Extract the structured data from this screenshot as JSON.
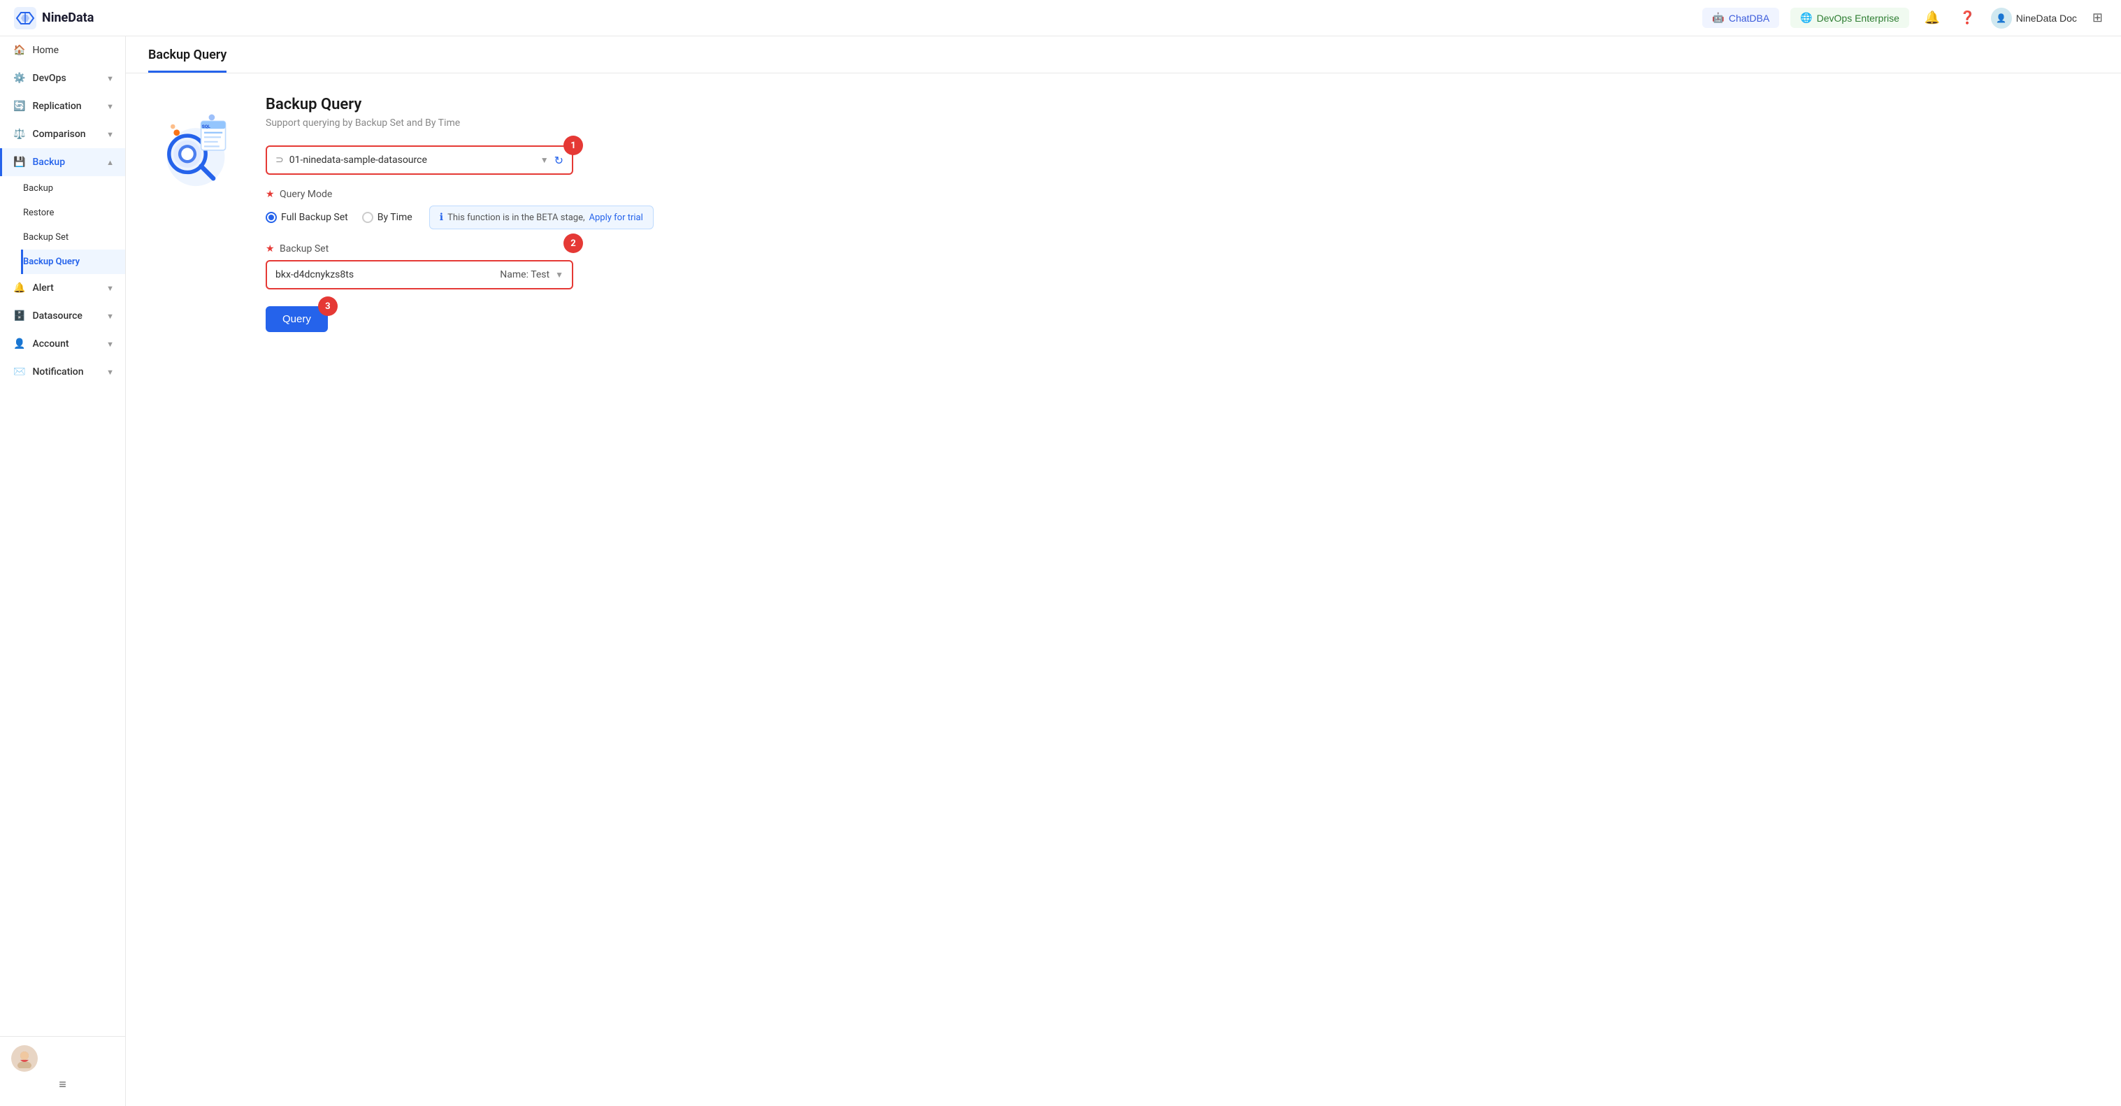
{
  "app": {
    "name": "NineData"
  },
  "navbar": {
    "logo_text": "NineData",
    "chatdba_label": "ChatDBA",
    "devops_label": "DevOps Enterprise",
    "user_label": "NineData Doc",
    "notification_icon": "🔔",
    "help_icon": "?",
    "doc_icon": "📄"
  },
  "sidebar": {
    "items": [
      {
        "id": "home",
        "label": "Home",
        "icon": "🏠",
        "chevron": false,
        "active": false
      },
      {
        "id": "devops",
        "label": "DevOps",
        "icon": "⚙️",
        "chevron": true,
        "active": false
      },
      {
        "id": "replication",
        "label": "Replication",
        "icon": "🔄",
        "chevron": true,
        "active": false
      },
      {
        "id": "comparison",
        "label": "Comparison",
        "icon": "⚖️",
        "chevron": true,
        "active": false
      },
      {
        "id": "backup",
        "label": "Backup",
        "icon": "💾",
        "chevron": true,
        "active": true
      }
    ],
    "backup_subitems": [
      {
        "id": "backup-sub",
        "label": "Backup",
        "active": false
      },
      {
        "id": "restore",
        "label": "Restore",
        "active": false
      },
      {
        "id": "backup-set",
        "label": "Backup Set",
        "active": false
      },
      {
        "id": "backup-query",
        "label": "Backup Query",
        "active": true
      }
    ],
    "more_items": [
      {
        "id": "alert",
        "label": "Alert",
        "icon": "🔔",
        "chevron": true
      },
      {
        "id": "datasource",
        "label": "Datasource",
        "icon": "🗄️",
        "chevron": true
      },
      {
        "id": "account",
        "label": "Account",
        "icon": "👤",
        "chevron": true
      },
      {
        "id": "notification",
        "label": "Notification",
        "icon": "✉️",
        "chevron": true
      }
    ]
  },
  "page": {
    "title": "Backup Query",
    "breadcrumb": "Backup Query"
  },
  "form": {
    "main_title": "Backup Query",
    "subtitle": "Support querying by Backup Set and By Time",
    "datasource_label": "01-ninedata-sample-datasource",
    "step1_badge": "1",
    "step2_badge": "2",
    "step3_badge": "3",
    "query_mode_label": "Query Mode",
    "full_backup_label": "Full Backup Set",
    "by_time_label": "By Time",
    "beta_text": "This function is in the BETA stage,",
    "beta_link": "Apply for trial",
    "backup_set_label": "Backup Set",
    "backup_set_id": "bkx-d4dcnykzs8ts",
    "backup_set_name": "Name: Test",
    "query_button": "Query"
  }
}
